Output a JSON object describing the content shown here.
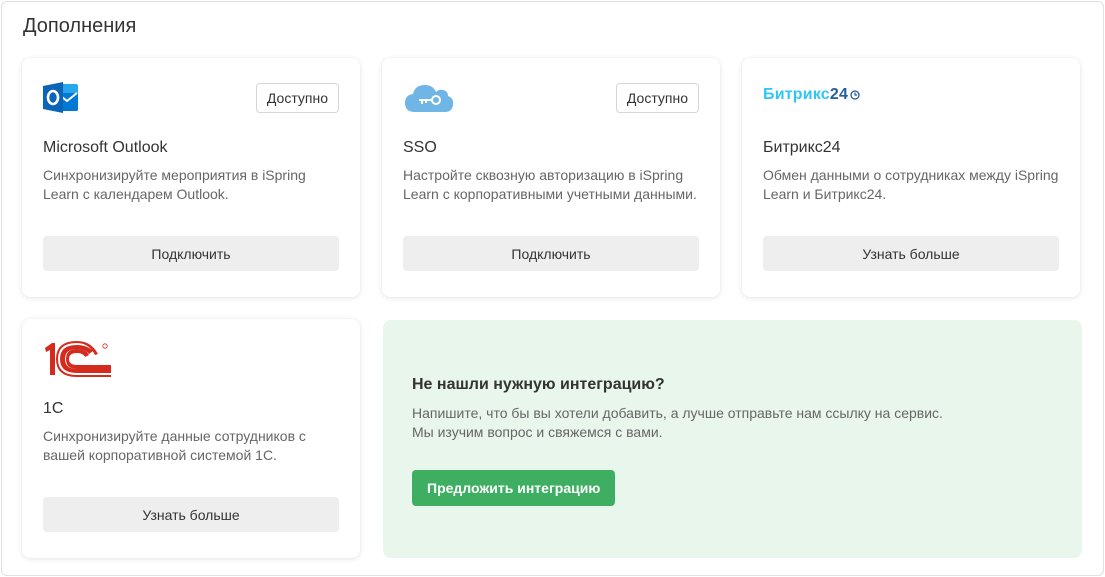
{
  "page": {
    "title": "Дополнения"
  },
  "colors": {
    "accent_green": "#3eaf62",
    "promo_bg": "#e9f6ec",
    "outlook_blue": "#0a64b8",
    "sso_cloud": "#6fb5e6",
    "bitrix_cyan": "#2fc6f6",
    "bitrix_navy": "#215f98",
    "onec_red": "#d52b1e"
  },
  "cards": [
    {
      "icon": "outlook-logo-icon",
      "badge": "Доступно",
      "title": "Microsoft Outlook",
      "description": "Синхронизируйте мероприятия в iSpring Learn с календарем Outlook.",
      "button": "Подключить"
    },
    {
      "icon": "sso-cloud-key-icon",
      "badge": "Доступно",
      "title": "SSO",
      "description": "Настройте сквозную авторизацию в iSpring Learn с корпоративными учетными данными.",
      "button": "Подключить"
    },
    {
      "icon": "bitrix24-logo",
      "logo_text": "Битрикс",
      "logo_number": "24",
      "title": "Битрикс24",
      "description": "Обмен данными о сотрудниках между iSpring Learn и Битрикс24.",
      "button": "Узнать больше"
    },
    {
      "icon": "1c-logo-icon",
      "title": "1С",
      "description": "Синхронизируйте данные сотрудников с вашей корпоративной системой 1С.",
      "button": "Узнать больше"
    }
  ],
  "promo": {
    "title": "Не нашли нужную интеграцию?",
    "line1": "Напишите, что бы вы хотели добавить, а лучше отправьте нам ссылку на сервис.",
    "line2": "Мы изучим вопрос и свяжемся с вами.",
    "button": "Предложить интеграцию"
  }
}
